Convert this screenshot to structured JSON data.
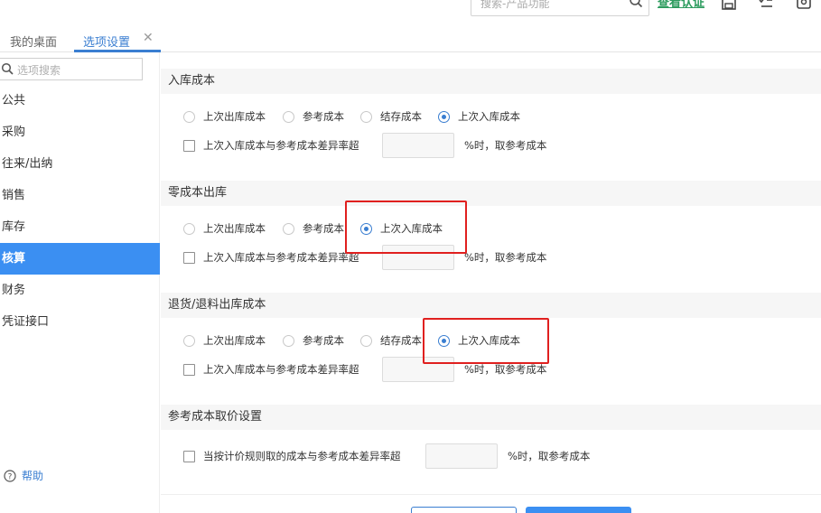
{
  "topbar": {
    "search_placeholder": "搜索-产品功能",
    "verify_link": "查看认证"
  },
  "tabs": [
    {
      "label": "我的桌面"
    },
    {
      "label": "选项设置",
      "active": true
    }
  ],
  "sidebar": {
    "search_placeholder": "选项搜索",
    "items": [
      {
        "label": "公共"
      },
      {
        "label": "采购"
      },
      {
        "label": "往来/出纳"
      },
      {
        "label": "销售"
      },
      {
        "label": "库存"
      },
      {
        "label": "核算",
        "active": true
      },
      {
        "label": "财务"
      },
      {
        "label": "凭证接口"
      }
    ],
    "help": "帮助"
  },
  "sections": [
    {
      "title": "入库成本",
      "options": [
        "上次出库成本",
        "参考成本",
        "结存成本",
        "上次入库成本"
      ],
      "selected": "上次入库成本",
      "check_label": "上次入库成本与参考成本差异率超",
      "suffix": "%时，取参考成本"
    },
    {
      "title": "零成本出库",
      "options": [
        "上次出库成本",
        "参考成本",
        "上次入库成本"
      ],
      "selected": "上次入库成本",
      "check_label": "上次入库成本与参考成本差异率超",
      "suffix": "%时，取参考成本"
    },
    {
      "title": "退货/退料出库成本",
      "options": [
        "上次出库成本",
        "参考成本",
        "结存成本",
        "上次入库成本"
      ],
      "selected": "上次入库成本",
      "check_label": "上次入库成本与参考成本差异率超",
      "suffix": "%时，取参考成本"
    },
    {
      "title": "参考成本取价设置",
      "check_label": "当按计价规则取的成本与参考成本差异率超",
      "suffix": "%时，取参考成本"
    }
  ],
  "colors": {
    "accent": "#3b8ff2",
    "link_green": "#2e9c5f",
    "highlight": "#e0201f"
  }
}
